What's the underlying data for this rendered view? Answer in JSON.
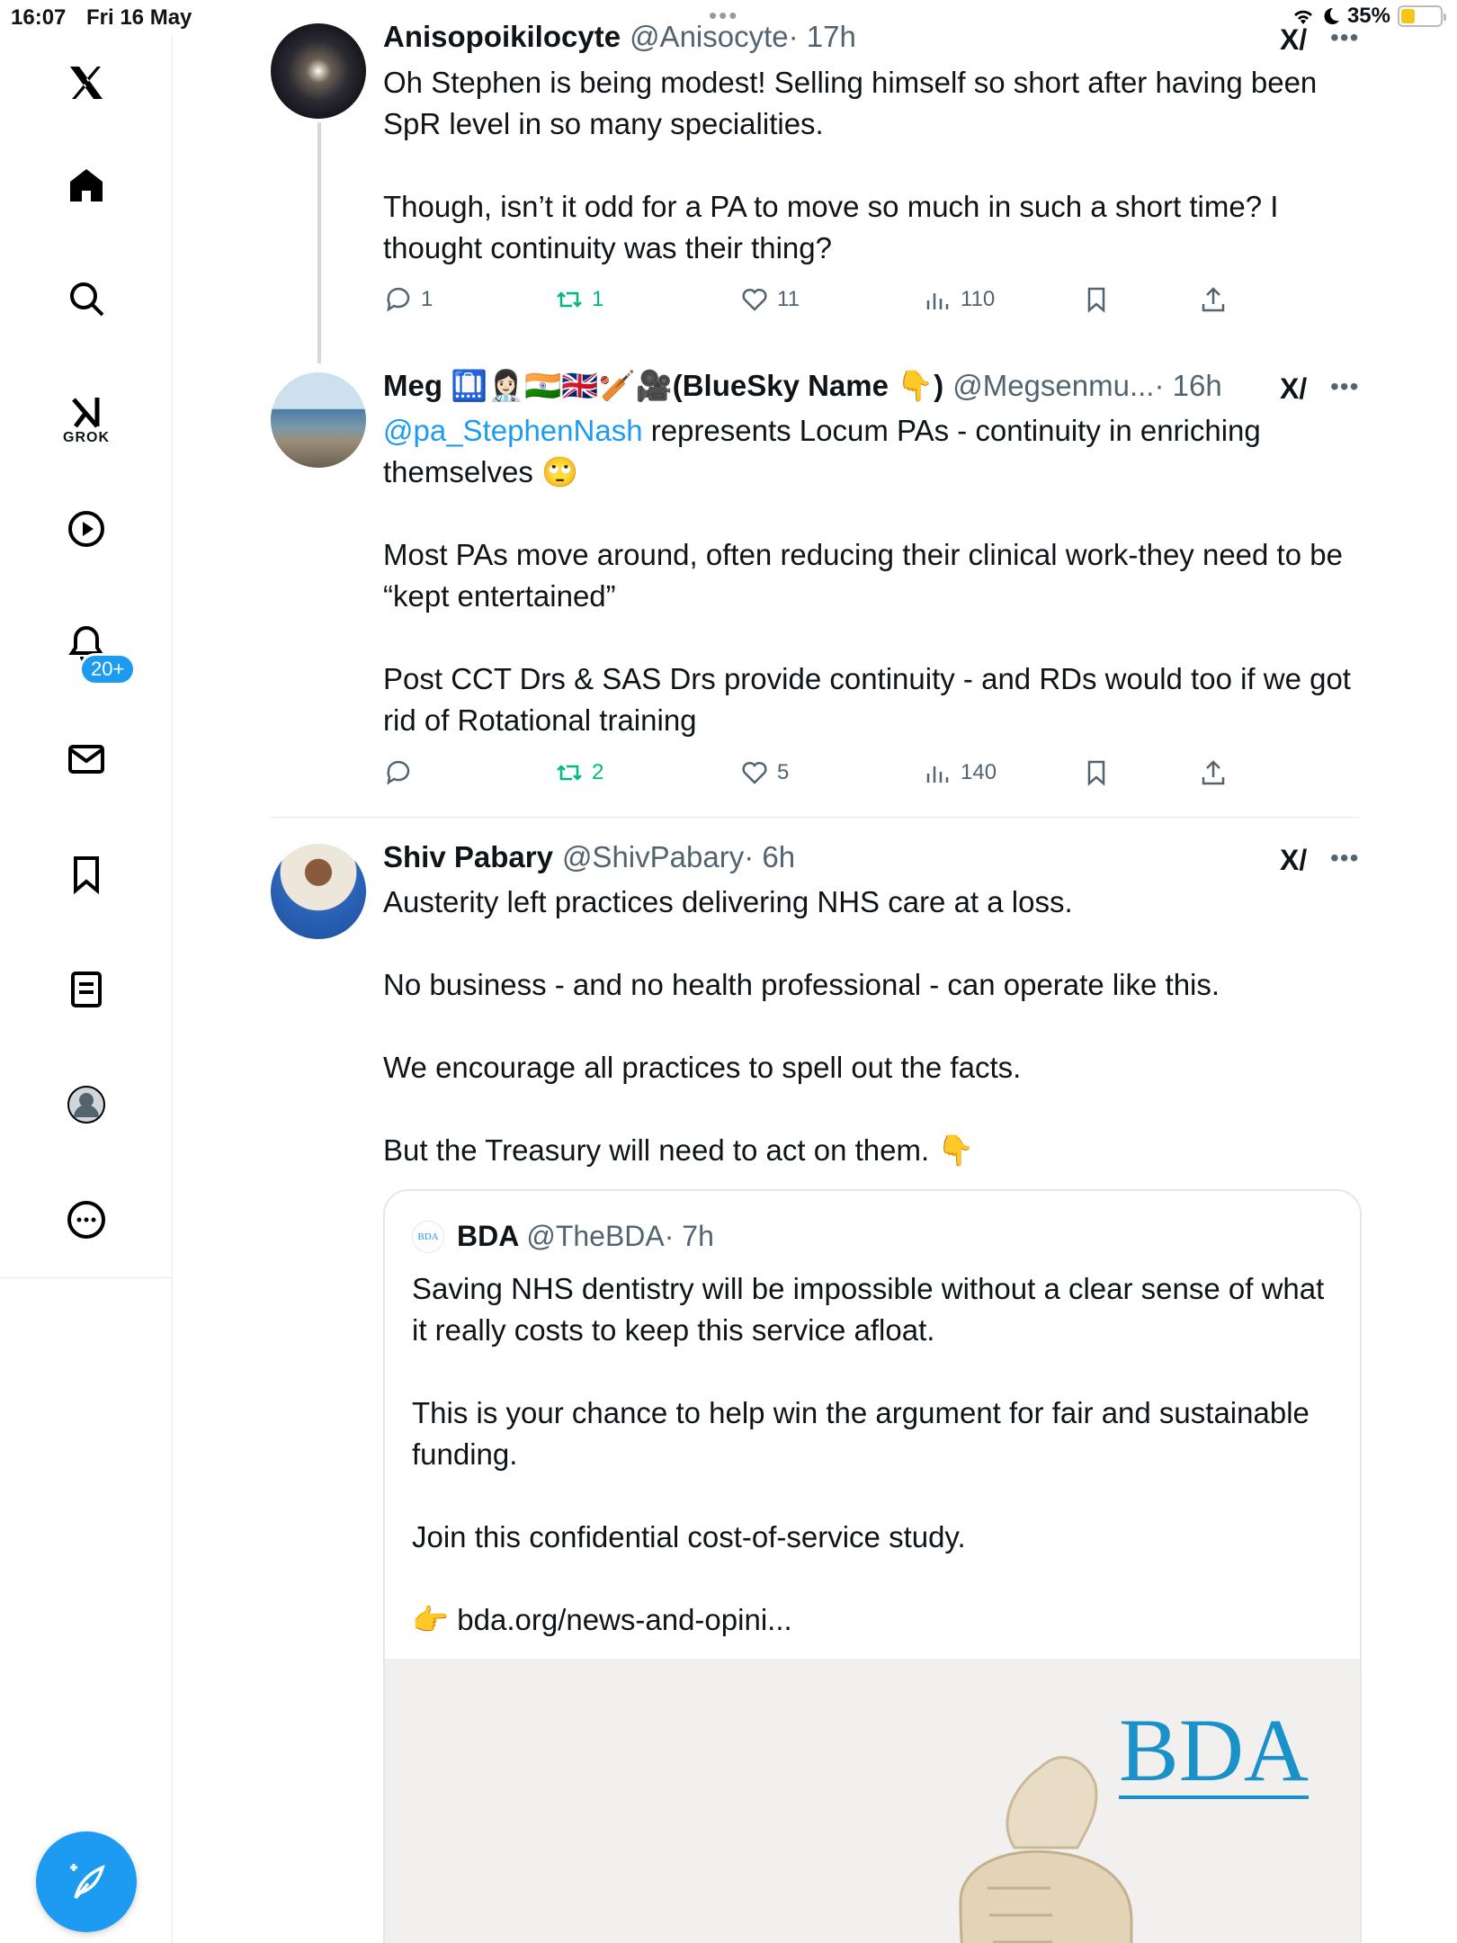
{
  "status": {
    "time": "16:07",
    "date": "Fri 16 May",
    "battery": "35%",
    "battery_level": 0.35
  },
  "sidebar": {
    "grok_label": "GROK",
    "notifications_badge": "20+"
  },
  "tweets": [
    {
      "name": "Anisopoikilocyte",
      "handle": "@Anisocyte",
      "time": "· 17h",
      "body": [
        "Oh Stephen is being modest! Selling himself so short after having been SpR level in so many specialities.",
        "Though, isn’t it odd for a PA to move so much in such a short time? I thought continuity was their thing?"
      ],
      "replies": "1",
      "retweets": "1",
      "likes": "11",
      "views": "110"
    },
    {
      "name": "Meg 🛄👩🏻‍⚕️🇮🇳🇬🇧🏏🎥(BlueSky Name 👇)",
      "handle": "@Megsenmu...",
      "time": "· 16h",
      "mention": "@pa_StephenNash",
      "body_first": " represents Locum PAs - continuity in enriching themselves 🙄",
      "body": [
        "Most PAs move around, often reducing their clinical work-they need to be “kept entertained”",
        "Post CCT Drs & SAS Drs provide continuity - and RDs would too if we got rid of Rotational training"
      ],
      "replies": "",
      "retweets": "2",
      "likes": "5",
      "views": "140"
    },
    {
      "name": "Shiv Pabary",
      "handle": "@ShivPabary",
      "time": "· 6h",
      "body": [
        "Austerity left practices delivering NHS care at a loss.",
        "No business - and no health professional - can operate like this.",
        "We encourage all practices to spell out the facts.",
        "But the Treasury will need to act on them. 👇"
      ]
    }
  ],
  "quote": {
    "logo_text": "BDA",
    "name": "BDA",
    "handle": "@TheBDA",
    "time": "· 7h",
    "body": [
      "Saving NHS dentistry will be impossible without a clear sense of what it really costs to keep this service afloat.",
      "This is your chance to help win the argument for fair and sustainable funding.",
      "Join this confidential cost-of-service study.",
      "👉 bda.org/news-and-opini..."
    ],
    "image_logo": "BDA"
  },
  "icons": {
    "grok": "grok-icon",
    "more": "more-icon"
  },
  "colors": {
    "accent": "#1d9bf0",
    "retweet": "#00ba7c",
    "muted": "#536471"
  }
}
